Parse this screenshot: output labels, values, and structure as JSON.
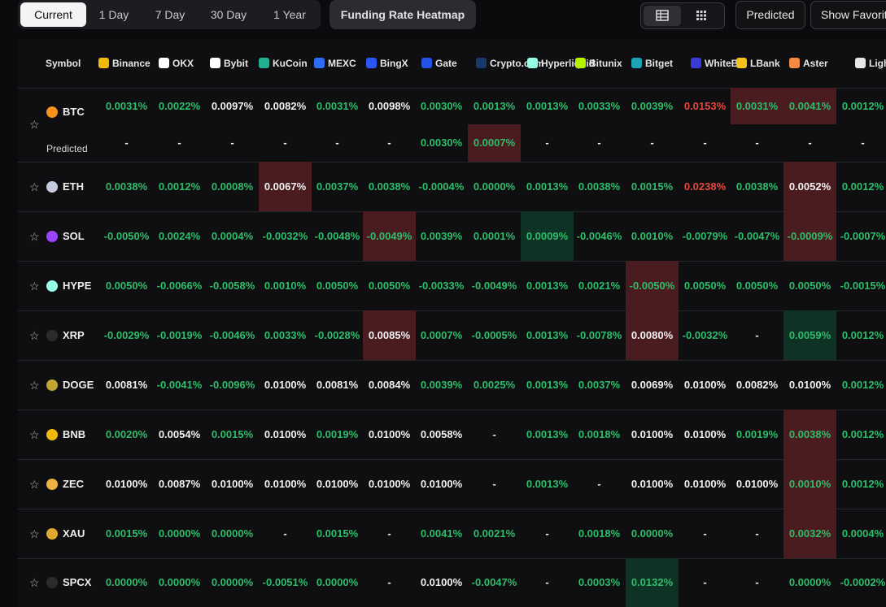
{
  "toolbar": {
    "periods": [
      "Current",
      "1 Day",
      "7 Day",
      "30 Day",
      "1 Year"
    ],
    "active_period": "Current",
    "heatmap_label": "Funding Rate Heatmap",
    "predicted_label": "Predicted",
    "show_favorites_label": "Show Favorites"
  },
  "table": {
    "symbol_header": "Symbol",
    "exchanges": [
      {
        "name": "Binance",
        "color": "#f0b90b"
      },
      {
        "name": "OKX",
        "color": "#ffffff"
      },
      {
        "name": "Bybit",
        "color": "#ffffff"
      },
      {
        "name": "KuCoin",
        "color": "#23af91"
      },
      {
        "name": "MEXC",
        "color": "#2c6cf6"
      },
      {
        "name": "BingX",
        "color": "#2a56f5"
      },
      {
        "name": "Gate",
        "color": "#2354e6"
      },
      {
        "name": "Crypto.com",
        "color": "#1a3a6b"
      },
      {
        "name": "Hyperliquid",
        "color": "#97fce4"
      },
      {
        "name": "Bitunix",
        "color": "#b4f000"
      },
      {
        "name": "Bitget",
        "color": "#1da2b4"
      },
      {
        "name": "WhiteBIT",
        "color": "#3a3ad6"
      },
      {
        "name": "LBank",
        "color": "#f4c31b"
      },
      {
        "name": "Aster",
        "color": "#f38a3f"
      },
      {
        "name": "Lighter",
        "color": "#e6e6e6"
      }
    ],
    "predicted_row_label": "Predicted",
    "rows": [
      {
        "symbol": "BTC",
        "icon_color": "#f7931a",
        "cells": [
          {
            "v": "0.0031%",
            "c": "g"
          },
          {
            "v": "0.0022%",
            "c": "g"
          },
          {
            "v": "0.0097%",
            "c": "w"
          },
          {
            "v": "0.0082%",
            "c": "w"
          },
          {
            "v": "0.0031%",
            "c": "g"
          },
          {
            "v": "0.0098%",
            "c": "w"
          },
          {
            "v": "0.0030%",
            "c": "g"
          },
          {
            "v": "0.0013%",
            "c": "g"
          },
          {
            "v": "0.0013%",
            "c": "g"
          },
          {
            "v": "0.0033%",
            "c": "g"
          },
          {
            "v": "0.0039%",
            "c": "g"
          },
          {
            "v": "0.0153%",
            "c": "r"
          },
          {
            "v": "0.0031%",
            "c": "g",
            "bg": "r"
          },
          {
            "v": "0.0041%",
            "c": "g",
            "bg": "r"
          },
          {
            "v": "0.0012%",
            "c": "g"
          }
        ],
        "predicted": [
          {
            "v": "-",
            "c": "w"
          },
          {
            "v": "-",
            "c": "w"
          },
          {
            "v": "-",
            "c": "w"
          },
          {
            "v": "-",
            "c": "w"
          },
          {
            "v": "-",
            "c": "w"
          },
          {
            "v": "-",
            "c": "w"
          },
          {
            "v": "0.0030%",
            "c": "g"
          },
          {
            "v": "0.0007%",
            "c": "g",
            "bg": "r"
          },
          {
            "v": "-",
            "c": "w"
          },
          {
            "v": "-",
            "c": "w"
          },
          {
            "v": "-",
            "c": "w"
          },
          {
            "v": "-",
            "c": "w"
          },
          {
            "v": "-",
            "c": "w"
          },
          {
            "v": "-",
            "c": "w"
          },
          {
            "v": "-",
            "c": "w"
          }
        ]
      },
      {
        "symbol": "ETH",
        "icon_color": "#c8cbe0",
        "cells": [
          {
            "v": "0.0038%",
            "c": "g"
          },
          {
            "v": "0.0012%",
            "c": "g"
          },
          {
            "v": "0.0008%",
            "c": "g"
          },
          {
            "v": "0.0067%",
            "c": "w",
            "bg": "r"
          },
          {
            "v": "0.0037%",
            "c": "g"
          },
          {
            "v": "0.0038%",
            "c": "g"
          },
          {
            "v": "-0.0004%",
            "c": "g"
          },
          {
            "v": "0.0000%",
            "c": "g"
          },
          {
            "v": "0.0013%",
            "c": "g"
          },
          {
            "v": "0.0038%",
            "c": "g"
          },
          {
            "v": "0.0015%",
            "c": "g"
          },
          {
            "v": "0.0238%",
            "c": "r"
          },
          {
            "v": "0.0038%",
            "c": "g"
          },
          {
            "v": "0.0052%",
            "c": "w",
            "bg": "r"
          },
          {
            "v": "0.0012%",
            "c": "g"
          }
        ]
      },
      {
        "symbol": "SOL",
        "icon_color": "#9945ff",
        "cells": [
          {
            "v": "-0.0050%",
            "c": "g"
          },
          {
            "v": "0.0024%",
            "c": "g"
          },
          {
            "v": "0.0004%",
            "c": "g"
          },
          {
            "v": "-0.0032%",
            "c": "g"
          },
          {
            "v": "-0.0048%",
            "c": "g"
          },
          {
            "v": "-0.0049%",
            "c": "g",
            "bg": "r"
          },
          {
            "v": "0.0039%",
            "c": "g"
          },
          {
            "v": "0.0001%",
            "c": "g"
          },
          {
            "v": "0.0009%",
            "c": "g",
            "bg": "g"
          },
          {
            "v": "-0.0046%",
            "c": "g"
          },
          {
            "v": "0.0010%",
            "c": "g"
          },
          {
            "v": "-0.0079%",
            "c": "g"
          },
          {
            "v": "-0.0047%",
            "c": "g"
          },
          {
            "v": "-0.0009%",
            "c": "g",
            "bg": "r"
          },
          {
            "v": "-0.0007%",
            "c": "g"
          }
        ]
      },
      {
        "symbol": "HYPE",
        "icon_color": "#97fce4",
        "cells": [
          {
            "v": "0.0050%",
            "c": "g"
          },
          {
            "v": "-0.0066%",
            "c": "g"
          },
          {
            "v": "-0.0058%",
            "c": "g"
          },
          {
            "v": "0.0010%",
            "c": "g"
          },
          {
            "v": "0.0050%",
            "c": "g"
          },
          {
            "v": "0.0050%",
            "c": "g"
          },
          {
            "v": "-0.0033%",
            "c": "g"
          },
          {
            "v": "-0.0049%",
            "c": "g"
          },
          {
            "v": "0.0013%",
            "c": "g"
          },
          {
            "v": "0.0021%",
            "c": "g"
          },
          {
            "v": "-0.0050%",
            "c": "g",
            "bg": "r"
          },
          {
            "v": "0.0050%",
            "c": "g"
          },
          {
            "v": "0.0050%",
            "c": "g"
          },
          {
            "v": "0.0050%",
            "c": "g"
          },
          {
            "v": "-0.0015%",
            "c": "g"
          }
        ]
      },
      {
        "symbol": "XRP",
        "icon_color": "#2b2b2e",
        "cells": [
          {
            "v": "-0.0029%",
            "c": "g"
          },
          {
            "v": "-0.0019%",
            "c": "g"
          },
          {
            "v": "-0.0046%",
            "c": "g"
          },
          {
            "v": "0.0033%",
            "c": "g"
          },
          {
            "v": "-0.0028%",
            "c": "g"
          },
          {
            "v": "0.0085%",
            "c": "w",
            "bg": "r"
          },
          {
            "v": "0.0007%",
            "c": "g"
          },
          {
            "v": "-0.0005%",
            "c": "g"
          },
          {
            "v": "0.0013%",
            "c": "g"
          },
          {
            "v": "-0.0078%",
            "c": "g"
          },
          {
            "v": "0.0080%",
            "c": "w",
            "bg": "r"
          },
          {
            "v": "-0.0032%",
            "c": "g"
          },
          {
            "v": "-",
            "c": "w"
          },
          {
            "v": "0.0059%",
            "c": "g",
            "bg": "g"
          },
          {
            "v": "0.0012%",
            "c": "g"
          }
        ]
      },
      {
        "symbol": "DOGE",
        "icon_color": "#c2a633",
        "cells": [
          {
            "v": "0.0081%",
            "c": "w"
          },
          {
            "v": "-0.0041%",
            "c": "g"
          },
          {
            "v": "-0.0096%",
            "c": "g"
          },
          {
            "v": "0.0100%",
            "c": "w"
          },
          {
            "v": "0.0081%",
            "c": "w"
          },
          {
            "v": "0.0084%",
            "c": "w"
          },
          {
            "v": "0.0039%",
            "c": "g"
          },
          {
            "v": "0.0025%",
            "c": "g"
          },
          {
            "v": "0.0013%",
            "c": "g"
          },
          {
            "v": "0.0037%",
            "c": "g"
          },
          {
            "v": "0.0069%",
            "c": "w"
          },
          {
            "v": "0.0100%",
            "c": "w"
          },
          {
            "v": "0.0082%",
            "c": "w"
          },
          {
            "v": "0.0100%",
            "c": "w"
          },
          {
            "v": "0.0012%",
            "c": "g"
          }
        ]
      },
      {
        "symbol": "BNB",
        "icon_color": "#f0b90b",
        "cells": [
          {
            "v": "0.0020%",
            "c": "g"
          },
          {
            "v": "0.0054%",
            "c": "w"
          },
          {
            "v": "0.0015%",
            "c": "g"
          },
          {
            "v": "0.0100%",
            "c": "w"
          },
          {
            "v": "0.0019%",
            "c": "g"
          },
          {
            "v": "0.0100%",
            "c": "w"
          },
          {
            "v": "0.0058%",
            "c": "w"
          },
          {
            "v": "-",
            "c": "w"
          },
          {
            "v": "0.0013%",
            "c": "g"
          },
          {
            "v": "0.0018%",
            "c": "g"
          },
          {
            "v": "0.0100%",
            "c": "w"
          },
          {
            "v": "0.0100%",
            "c": "w"
          },
          {
            "v": "0.0019%",
            "c": "g"
          },
          {
            "v": "0.0038%",
            "c": "g",
            "bg": "r"
          },
          {
            "v": "0.0012%",
            "c": "g"
          }
        ]
      },
      {
        "symbol": "ZEC",
        "icon_color": "#ecb244",
        "cells": [
          {
            "v": "0.0100%",
            "c": "w"
          },
          {
            "v": "0.0087%",
            "c": "w"
          },
          {
            "v": "0.0100%",
            "c": "w"
          },
          {
            "v": "0.0100%",
            "c": "w"
          },
          {
            "v": "0.0100%",
            "c": "w"
          },
          {
            "v": "0.0100%",
            "c": "w"
          },
          {
            "v": "0.0100%",
            "c": "w"
          },
          {
            "v": "-",
            "c": "w"
          },
          {
            "v": "0.0013%",
            "c": "g"
          },
          {
            "v": "-",
            "c": "w"
          },
          {
            "v": "0.0100%",
            "c": "w"
          },
          {
            "v": "0.0100%",
            "c": "w"
          },
          {
            "v": "0.0100%",
            "c": "w"
          },
          {
            "v": "0.0010%",
            "c": "g",
            "bg": "r"
          },
          {
            "v": "0.0012%",
            "c": "g"
          }
        ]
      },
      {
        "symbol": "XAU",
        "icon_color": "#e0a82e",
        "cells": [
          {
            "v": "0.0015%",
            "c": "g"
          },
          {
            "v": "0.0000%",
            "c": "g"
          },
          {
            "v": "0.0000%",
            "c": "g"
          },
          {
            "v": "-",
            "c": "w"
          },
          {
            "v": "0.0015%",
            "c": "g"
          },
          {
            "v": "-",
            "c": "w"
          },
          {
            "v": "0.0041%",
            "c": "g"
          },
          {
            "v": "0.0021%",
            "c": "g"
          },
          {
            "v": "-",
            "c": "w"
          },
          {
            "v": "0.0018%",
            "c": "g"
          },
          {
            "v": "0.0000%",
            "c": "g"
          },
          {
            "v": "-",
            "c": "w"
          },
          {
            "v": "-",
            "c": "w"
          },
          {
            "v": "0.0032%",
            "c": "g",
            "bg": "r"
          },
          {
            "v": "0.0004%",
            "c": "g"
          }
        ]
      },
      {
        "symbol": "SPCX",
        "icon_color": "#2b2b2e",
        "cells": [
          {
            "v": "0.0000%",
            "c": "g"
          },
          {
            "v": "0.0000%",
            "c": "g"
          },
          {
            "v": "0.0000%",
            "c": "g"
          },
          {
            "v": "-0.0051%",
            "c": "g"
          },
          {
            "v": "0.0000%",
            "c": "g"
          },
          {
            "v": "-",
            "c": "w"
          },
          {
            "v": "0.0100%",
            "c": "w"
          },
          {
            "v": "-0.0047%",
            "c": "g"
          },
          {
            "v": "-",
            "c": "w"
          },
          {
            "v": "0.0003%",
            "c": "g"
          },
          {
            "v": "0.0132%",
            "c": "g",
            "bg": "g"
          },
          {
            "v": "-",
            "c": "w"
          },
          {
            "v": "-",
            "c": "w"
          },
          {
            "v": "0.0000%",
            "c": "g"
          },
          {
            "v": "-0.0002%",
            "c": "g"
          }
        ]
      }
    ]
  }
}
